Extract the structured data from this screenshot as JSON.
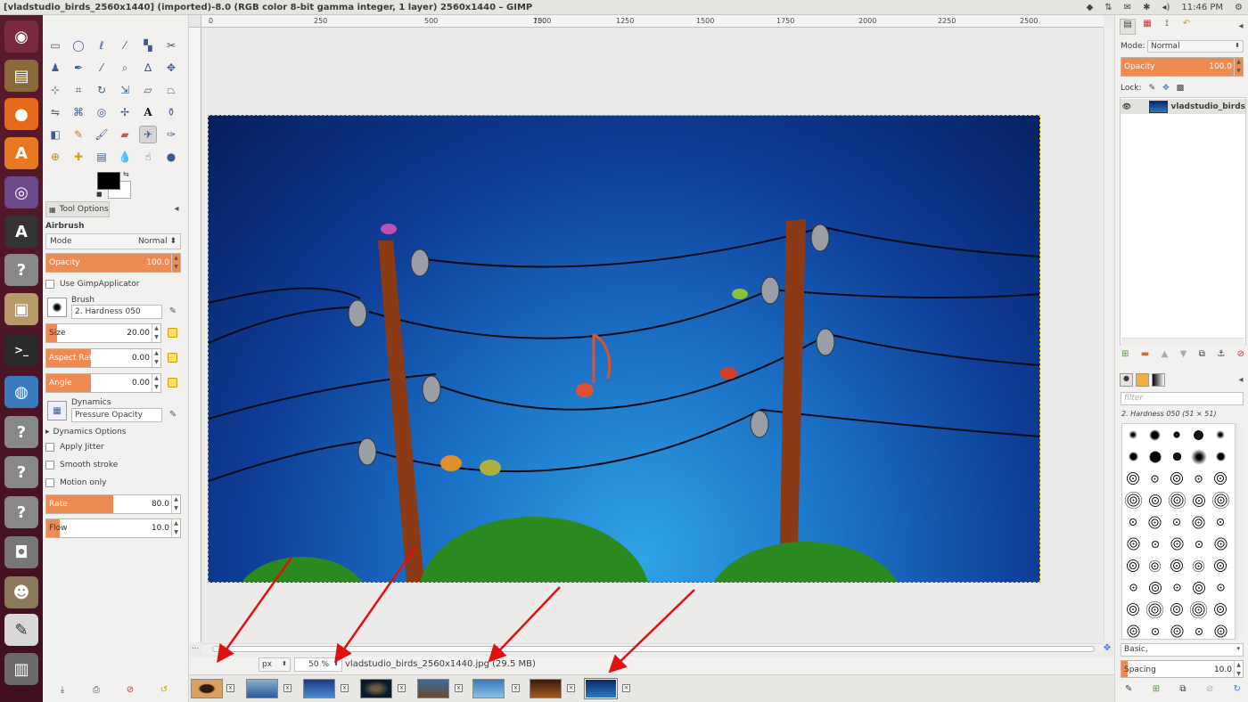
{
  "window": {
    "title": "[vladstudio_birds_2560x1440] (imported)-8.0 (RGB color 8-bit gamma integer, 1 layer) 2560x1440 – GIMP"
  },
  "tray": {
    "time": "11:46 PM"
  },
  "ruler": {
    "ticks": [
      "0",
      "250",
      "500",
      "750",
      "1000",
      "1250",
      "1500",
      "1750",
      "2000",
      "2250",
      "2500"
    ]
  },
  "tool_options": {
    "tab_label": "Tool Options",
    "tool_name": "Airbrush",
    "mode_label": "Mode",
    "mode_value": "Normal",
    "opacity_label": "Opacity",
    "opacity_value": "100.0",
    "use_gimp_applicator": "Use GimpApplicator",
    "brush_label": "Brush",
    "brush_value": "2. Hardness 050",
    "size_label": "Size",
    "size_value": "20.00",
    "aspect_label": "Aspect Ratio",
    "aspect_value": "0.00",
    "angle_label": "Angle",
    "angle_value": "0.00",
    "dynamics_label": "Dynamics",
    "dynamics_value": "Pressure Opacity",
    "dynamics_options": "Dynamics Options",
    "apply_jitter": "Apply Jitter",
    "smooth_stroke": "Smooth stroke",
    "motion_only": "Motion only",
    "rate_label": "Rate",
    "rate_value": "80.0",
    "flow_label": "Flow",
    "flow_value": "10.0",
    "opacity_fill": 1.0,
    "size_fill": 0.09,
    "aspect_fill": 0.39,
    "angle_fill": 0.39,
    "rate_fill": 0.5,
    "flow_fill": 0.1
  },
  "status": {
    "unit": "px",
    "zoom": "50 %",
    "filename": "vladstudio_birds_2560x1440.jpg (29.5 MB)"
  },
  "layers": {
    "mode_label": "Mode:",
    "mode_value": "Normal",
    "opacity_label": "Opacity",
    "opacity_value": "100.0",
    "lock_label": "Lock:",
    "layer_name": "vladstudio_birds"
  },
  "brushes": {
    "filter_placeholder": "filter",
    "current": "2. Hardness 050 (51 × 51)",
    "preset": "Basic,",
    "spacing_label": "Spacing",
    "spacing_value": "10.0"
  },
  "colors": {
    "accent": "#ef8a50",
    "launcher": "#5a1b2c",
    "sky_dark": "#061f5e",
    "sky_light": "#2fa4e6",
    "arrow": "#e01010"
  }
}
